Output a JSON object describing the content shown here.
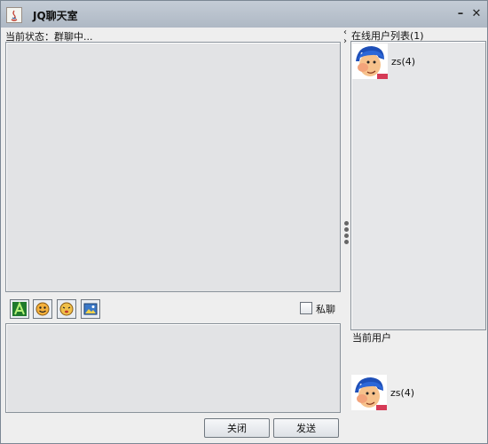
{
  "window": {
    "title": "JQ聊天室",
    "minimize_glyph": "–",
    "close_glyph": "✕"
  },
  "status": {
    "text": "当前状态：群聊中..."
  },
  "toolbar": {
    "icons": [
      "font-icon",
      "emoji-icon",
      "shake-icon",
      "image-icon"
    ],
    "private_label": "私聊",
    "private_checked": false
  },
  "buttons": {
    "close_label": "关闭",
    "send_label": "发送"
  },
  "online_panel": {
    "title": "在线用户列表(1)",
    "users": [
      {
        "name": "zs(4)",
        "avatar": "avatar-icon"
      }
    ]
  },
  "current_user": {
    "label": "当前用户",
    "name": "zs(4)",
    "avatar": "avatar-icon"
  },
  "divider": {
    "left_arrow": "‹",
    "right_arrow": "›"
  }
}
